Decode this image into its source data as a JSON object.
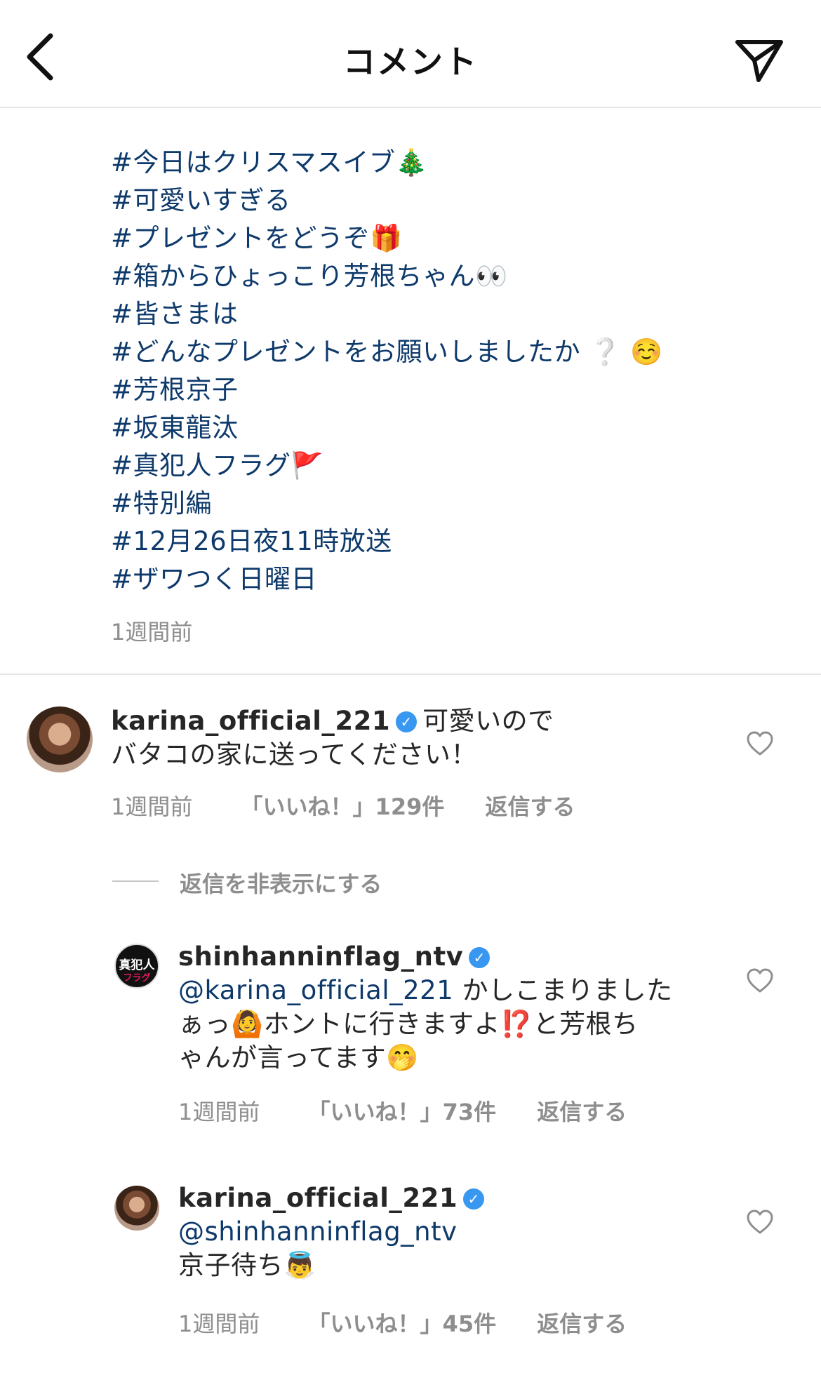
{
  "header": {
    "title": "コメント",
    "back_icon": "chevron-left-icon",
    "send_icon": "paper-plane-icon"
  },
  "caption": {
    "lines": [
      {
        "text": "#今日はクリスマスイブ",
        "emoji": "🎄"
      },
      {
        "text": "#可愛いすぎる",
        "emoji": ""
      },
      {
        "text": "#プレゼントをどうぞ",
        "emoji": "🎁"
      },
      {
        "text": "#箱からひょっこり芳根ちゃん",
        "emoji": "👀"
      },
      {
        "text": "#皆さまは",
        "emoji": ""
      },
      {
        "text": "#どんなプレゼントをお願いしましたか",
        "emoji": "❔ ☺️"
      },
      {
        "text": "#芳根京子",
        "emoji": ""
      },
      {
        "text": "#坂東龍汰",
        "emoji": ""
      },
      {
        "text": "#真犯人フラグ",
        "emoji": "🚩"
      },
      {
        "text": "#特別編",
        "emoji": ""
      },
      {
        "text": "#12月26日夜11時放送",
        "emoji": ""
      },
      {
        "text": "#ザワつく日曜日",
        "emoji": ""
      }
    ],
    "time": "1週間前"
  },
  "comments": [
    {
      "username": "karina_official_221",
      "verified": true,
      "text_part1": "可愛いので",
      "text_part2": "バタコの家に送ってください！",
      "time": "1週間前",
      "likes": "「いいね！」129件",
      "reply": "返信する"
    }
  ],
  "hide_replies": "返信を非表示にする",
  "replies": [
    {
      "username": "shinhanninflag_ntv",
      "verified": true,
      "avatar_top": "真犯人",
      "avatar_bottom": "フラグ",
      "mention": "@karina_official_221",
      "text_a": " かしこまりました",
      "text_b": "ぁっ",
      "emoji_a": "🙆",
      "text_c": "ホントに行きますよ",
      "emoji_b": "⁉️",
      "text_d": "と芳根ち",
      "text_e": "ゃんが言ってます",
      "emoji_c": "🤭",
      "time": "1週間前",
      "likes": "「いいね！」73件",
      "reply": "返信する"
    },
    {
      "username": "karina_official_221",
      "verified": true,
      "mention": "@shinhanninflag_ntv",
      "text_a": "京子待ち",
      "emoji_a": "👼",
      "time": "1週間前",
      "likes": "「いいね！」45件",
      "reply": "返信する"
    }
  ],
  "colors": {
    "hashtag": "#0e3a6b",
    "verified": "#3897f0",
    "meta": "#8e8e8e"
  }
}
